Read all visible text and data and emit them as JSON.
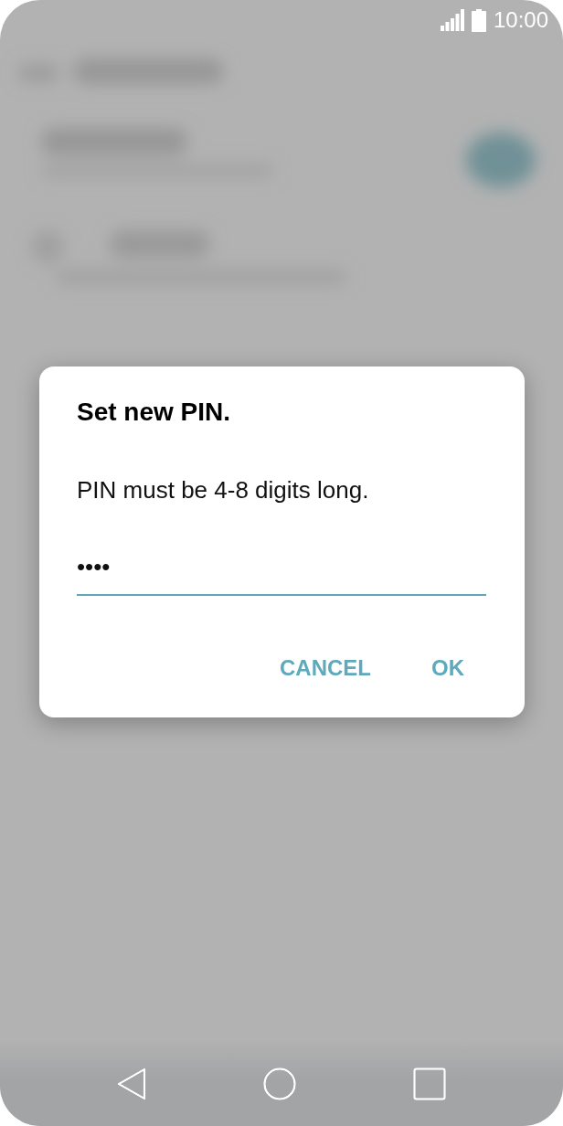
{
  "status_bar": {
    "time": "10:00"
  },
  "dialog": {
    "title": "Set new PIN.",
    "message": "PIN must be 4-8 digits long.",
    "pin_field": {
      "value": "••••"
    },
    "buttons": [
      {
        "label": "CANCEL"
      },
      {
        "label": "OK"
      }
    ]
  },
  "nav_bar": {
    "buttons": [
      {
        "kind": "back"
      },
      {
        "kind": "home"
      },
      {
        "kind": "recents"
      }
    ]
  }
}
